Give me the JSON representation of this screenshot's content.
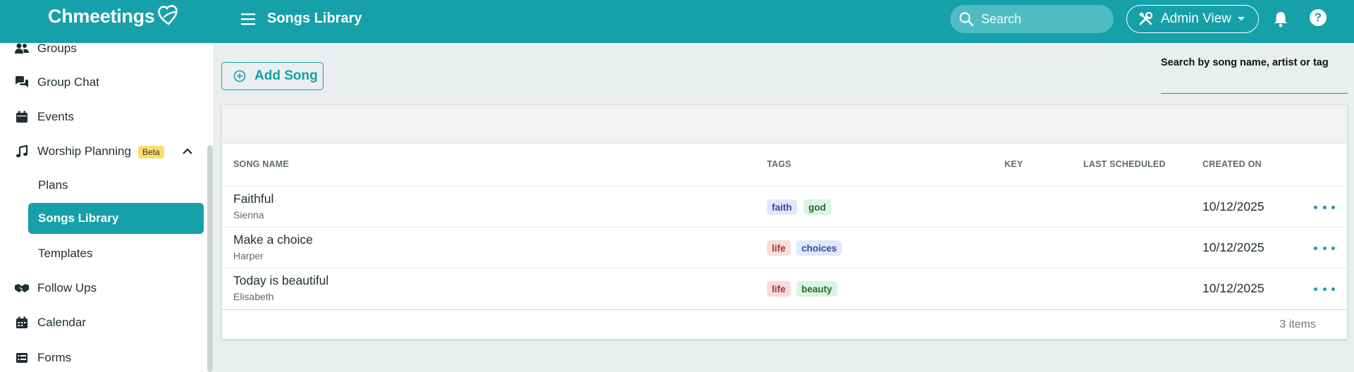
{
  "app": {
    "logo_text": "Chmeetings",
    "page_title": "Songs Library",
    "search_placeholder": "Search",
    "admin_view_label": "Admin View",
    "help_label": "?"
  },
  "sidebar": {
    "items": [
      {
        "label": "Groups",
        "icon": "groups-icon"
      },
      {
        "label": "Group Chat",
        "icon": "chat-icon"
      },
      {
        "label": "Events",
        "icon": "calendar-icon"
      },
      {
        "label": "Worship Planning",
        "icon": "music-note-icon",
        "badge": "Beta"
      },
      {
        "label": "Follow Ups",
        "icon": "handshake-icon"
      },
      {
        "label": "Calendar",
        "icon": "calendar-grid-icon"
      },
      {
        "label": "Forms",
        "icon": "forms-icon"
      }
    ],
    "worship_sub": [
      {
        "label": "Plans"
      },
      {
        "label": "Songs Library",
        "active": true
      },
      {
        "label": "Templates"
      }
    ]
  },
  "toolbar": {
    "add_song_label": "Add Song",
    "search_label": "Search by song name, artist or tag",
    "search_value": ""
  },
  "table": {
    "headers": {
      "song_name": "SONG NAME",
      "tags": "TAGS",
      "key": "KEY",
      "last_scheduled": "LAST SCHEDULED",
      "created_on": "CREATED ON"
    },
    "rows": [
      {
        "name": "Faithful",
        "artist": "Sienna",
        "tags": [
          {
            "text": "faith",
            "color": "blue"
          },
          {
            "text": "god",
            "color": "green"
          }
        ],
        "key": "",
        "last_scheduled": "",
        "created_on": "10/12/2025"
      },
      {
        "name": "Make a choice",
        "artist": "Harper",
        "tags": [
          {
            "text": "life",
            "color": "red"
          },
          {
            "text": "choices",
            "color": "blue"
          }
        ],
        "key": "",
        "last_scheduled": "",
        "created_on": "10/12/2025"
      },
      {
        "name": "Today is beautiful",
        "artist": "Elisabeth",
        "tags": [
          {
            "text": "life",
            "color": "red"
          },
          {
            "text": "beauty",
            "color": "green"
          }
        ],
        "key": "",
        "last_scheduled": "",
        "created_on": "10/12/2025"
      }
    ],
    "items_count": "3 items"
  },
  "colors": {
    "accent": "#16a0a9",
    "beta_badge": "#f9de6d",
    "tag_blue": "#e2e8fb",
    "tag_green": "#dcf3e1",
    "tag_red": "#f9dcdc"
  }
}
